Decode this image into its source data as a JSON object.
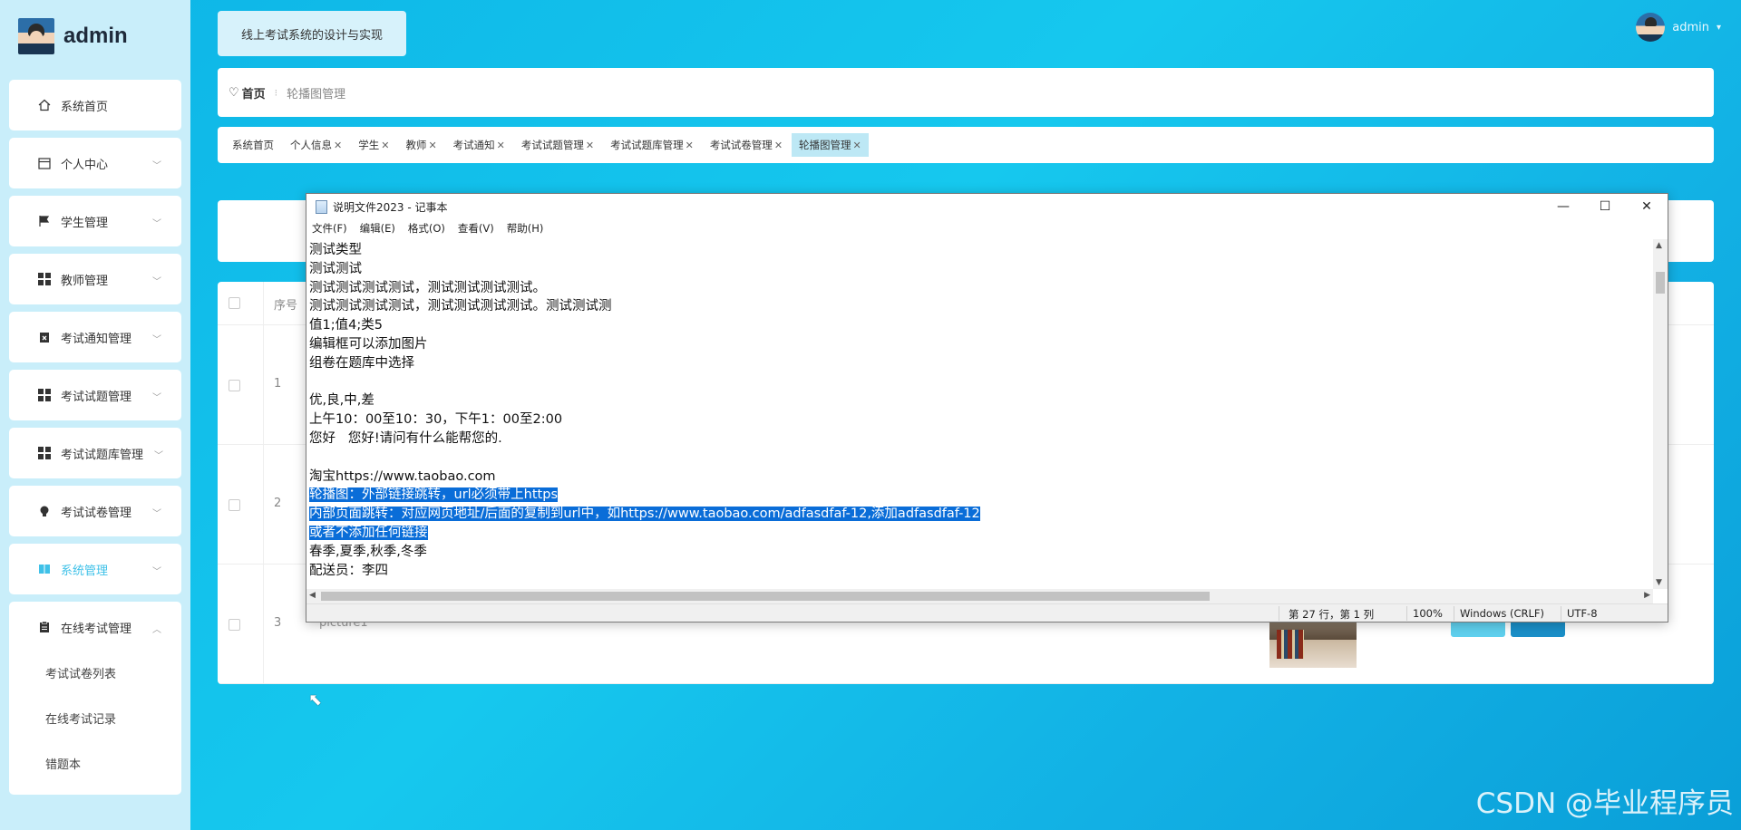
{
  "brand": {
    "name": "admin"
  },
  "site_title": "线上考试系统的设计与实现",
  "user": {
    "name": "admin"
  },
  "sidebar": {
    "items": [
      {
        "label": "系统首页"
      },
      {
        "label": "个人中心"
      },
      {
        "label": "学生管理"
      },
      {
        "label": "教师管理"
      },
      {
        "label": "考试通知管理"
      },
      {
        "label": "考试试题管理"
      },
      {
        "label": "考试试题库管理"
      },
      {
        "label": "考试试卷管理"
      },
      {
        "label": "系统管理"
      },
      {
        "label": "在线考试管理"
      }
    ],
    "submenu": [
      {
        "label": "考试试卷列表"
      },
      {
        "label": "在线考试记录"
      },
      {
        "label": "错题本"
      }
    ]
  },
  "breadcrumb": {
    "home": "首页",
    "current": "轮播图管理"
  },
  "tabs": [
    {
      "label": "系统首页"
    },
    {
      "label": "个人信息"
    },
    {
      "label": "学生"
    },
    {
      "label": "教师"
    },
    {
      "label": "考试通知"
    },
    {
      "label": "考试试题管理"
    },
    {
      "label": "考试试题库管理"
    },
    {
      "label": "考试试卷管理"
    },
    {
      "label": "轮播图管理"
    }
  ],
  "table": {
    "header_seq": "序号",
    "rows": [
      {
        "seq": "1",
        "name": ""
      },
      {
        "seq": "2",
        "name": ""
      },
      {
        "seq": "3",
        "name": "picture1"
      }
    ]
  },
  "notepad": {
    "title": "说明文件2023 - 记事本",
    "menu": [
      "文件(F)",
      "编辑(E)",
      "格式(O)",
      "查看(V)",
      "帮助(H)"
    ],
    "lines": [
      "测试类型",
      "测试测试",
      "测试测试测试测试，测试测试测试测试。",
      "测试测试测试测试，测试测试测试测试。测试测试测",
      "值1;值4;类5",
      "编辑框可以添加图片",
      "组卷在题库中选择",
      "",
      "优,良,中,差",
      "上午10：00至10：30，下午1：00至2:00",
      "您好   您好!请问有什么能帮您的.",
      "",
      "淘宝https://www.taobao.com",
      "轮播图：外部链接跳转，url必须带上https",
      "内部页面跳转：对应网页地址/后面的复制到url中，如https://www.taobao.com/adfasdfaf-12,添加adfasdfaf-12",
      "或者不添加任何链接",
      "春季,夏季,秋季,冬季",
      "配送员：李四"
    ],
    "status": {
      "position": "第 27 行，第 1 列",
      "zoom": "100%",
      "line_ending": "Windows (CRLF)",
      "encoding": "UTF-8"
    }
  },
  "watermark": "CSDN @毕业程序员",
  "colors": {
    "accent": "#3fc1e8",
    "selection": "#0a6dd8",
    "sidebar_bg": "#c9eefa"
  }
}
